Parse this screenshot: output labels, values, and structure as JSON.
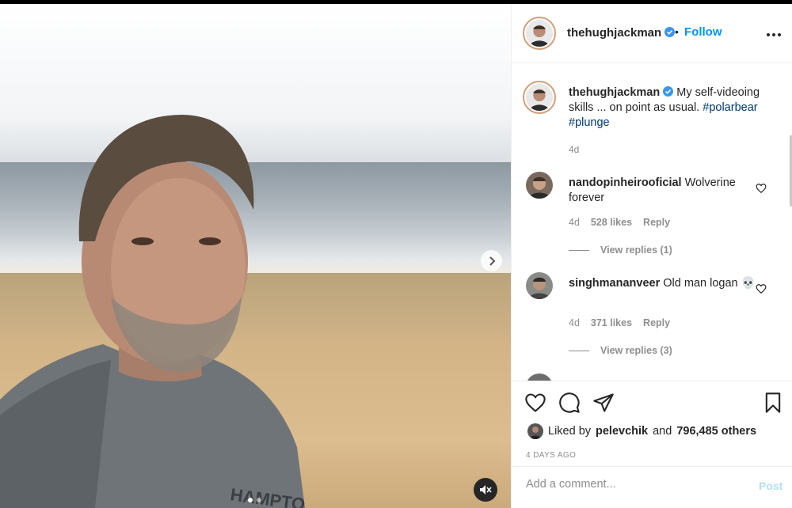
{
  "post": {
    "author": "thehughjackman",
    "follow_label": "Follow",
    "separator": "•",
    "caption": {
      "username": "thehughjackman",
      "text_before": "My self-videoing skills ... on point as usual.",
      "hashtags": [
        "#polarbear",
        "#plunge"
      ],
      "time": "4d"
    },
    "comments": [
      {
        "username": "nandopinheirooficial",
        "text": "Wolverine forever",
        "time": "4d",
        "likes": "528 likes",
        "reply_label": "Reply",
        "view_replies": "View replies (1)"
      },
      {
        "username": "singhmananveer",
        "text": "Old man logan 💀",
        "time": "4d",
        "likes": "371 likes",
        "reply_label": "Reply",
        "view_replies": "View replies (3)"
      }
    ],
    "liked_by": {
      "prefix": "Liked by",
      "user": "pelevchik",
      "conj": "and",
      "others": "796,485 others"
    },
    "ago": "4 DAYS AGO",
    "add_comment_placeholder": "Add a comment...",
    "post_label": "Post"
  },
  "media": {
    "carousel_count": 2,
    "active_index": 0,
    "next_icon": "chevron-right-icon",
    "mute_icon": "speaker-muted-icon"
  },
  "colors": {
    "accent": "#0095f6",
    "hashtag": "#00376b",
    "muted": "#8e8e8e",
    "verified": "#3897f0"
  }
}
